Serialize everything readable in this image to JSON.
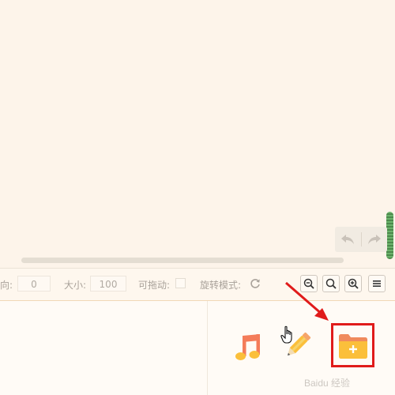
{
  "toolbar": {
    "direction_label": "向:",
    "direction_value": "0",
    "size_label": "大小:",
    "size_value": "100",
    "draggable_label": "可拖动:",
    "rotate_mode_label": "旋转模式:"
  },
  "icons": {
    "undo": "undo-icon",
    "redo": "redo-icon",
    "rotate": "rotate-icon",
    "zoom_out": "zoom-out-icon",
    "zoom_reset": "zoom-reset-icon",
    "zoom_in": "zoom-in-icon",
    "menu": "menu-icon",
    "music": "music-note-icon",
    "pencil": "pencil-icon",
    "new_folder": "new-folder-icon",
    "cursor": "hand-cursor-icon",
    "arrow": "red-arrow-annotation"
  },
  "colors": {
    "background": "#fdf4ea",
    "accent_green": "#5b9c5b",
    "highlight_red": "#e01b1b",
    "music_orange": "#f47c5a",
    "folder_yellow": "#fbbf3b"
  },
  "watermark": {
    "text": "Baidu 经验",
    "url": "jingyan.baidu.com"
  }
}
